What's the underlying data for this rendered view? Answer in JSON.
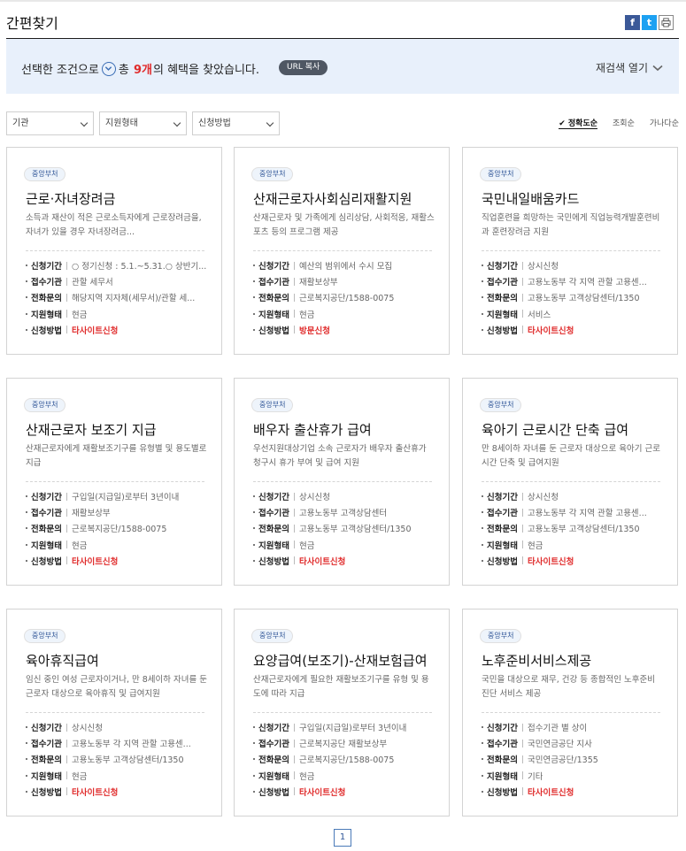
{
  "page": {
    "title": "간편찾기",
    "share_icons": [
      "facebook-icon",
      "twitter-icon",
      "print-icon"
    ]
  },
  "banner": {
    "text_before": "선택한 조건으로",
    "text_mid": "총",
    "count": "9개",
    "text_after": "의 혜택을 찾았습니다.",
    "url_copy": "URL 복사",
    "research_label": "재검색 열기"
  },
  "filters": [
    {
      "value": "기관"
    },
    {
      "value": "지원형태"
    },
    {
      "value": "신청방법"
    }
  ],
  "sort": {
    "accuracy": "정확도순",
    "views": "조회순",
    "alphabetical": "가나다순"
  },
  "labels": {
    "period": "신청기간",
    "agency": "접수기관",
    "phone": "전화문의",
    "support": "지원형태",
    "method": "신청방법"
  },
  "cards": [
    {
      "badge": "중앙부처",
      "title": "근로·자녀장려금",
      "desc": "소득과 재산이 적은 근로소득자에게 근로장려금을, 자녀가 있을 경우 자녀장려금...",
      "period": "○ 정기신청 : 5.1.~5.31.○ 상반기...",
      "agency": "관할 세무서",
      "phone": "해당지역 지자체(세무서)/관할 세...",
      "support": "현금",
      "method": "타사이트신청",
      "method_red": true
    },
    {
      "badge": "중앙부처",
      "title": "산재근로자사회심리재활지원",
      "desc": "산재근로자 및 가족에게 심리상담, 사회적응, 재활스포츠 등의 프로그램 제공",
      "period": "예산의 범위에서 수시 모집",
      "agency": "재활보상부",
      "phone": "근로복지공단/1588-0075",
      "support": "현금",
      "method": "방문신청",
      "method_red": true
    },
    {
      "badge": "중앙부처",
      "title": "국민내일배움카드",
      "desc": "직업훈련을 희망하는 국민에게 직업능력개발훈련비과 훈련장려금 지원",
      "period": "상시신청",
      "agency": "고용노동부 각 지역 관할 고용센...",
      "phone": "고용노동부 고객상담센터/1350",
      "support": "서비스",
      "method": "타사이트신청",
      "method_red": true
    },
    {
      "badge": "중앙부처",
      "title": "산재근로자 보조기 지급",
      "desc": "산재근로자에게 재활보조기구를 유형별 및 용도별로 지급",
      "period": "구입일(지급일)로부터 3년이내",
      "agency": "재활보상부",
      "phone": "근로복지공단/1588-0075",
      "support": "현금",
      "method": "타사이트신청",
      "method_red": true
    },
    {
      "badge": "중앙부처",
      "title": "배우자 출산휴가 급여",
      "desc": "우선지원대상기업 소속 근로자가 배우자 출산휴가 청구시 휴가 부여 및 급여 지원",
      "period": "상시신청",
      "agency": "고용노동부 고객상담센터",
      "phone": "고용노동부 고객상담센터/1350",
      "support": "현금",
      "method": "타사이트신청",
      "method_red": true
    },
    {
      "badge": "중앙부처",
      "title": "육아기 근로시간 단축 급여",
      "desc": "만 8세이하 자녀를 둔 근로자 대상으로 육아기 근로시간 단축 및 급여지원",
      "period": "상시신청",
      "agency": "고용노동부 각 지역 관할 고용센...",
      "phone": "고용노동부 고객상담센터/1350",
      "support": "현금",
      "method": "타사이트신청",
      "method_red": true
    },
    {
      "badge": "중앙부처",
      "title": "육아휴직급여",
      "desc": "임신 중인 여성 근로자이거나, 만 8세이하 자녀를 둔 근로자 대상으로 육아휴직 및 급여지원",
      "period": "상시신청",
      "agency": "고용노동부 각 지역 관할 고용센...",
      "phone": "고용노동부 고객상담센터/1350",
      "support": "현금",
      "method": "타사이트신청",
      "method_red": true
    },
    {
      "badge": "중앙부처",
      "title": "요양급여(보조기)-산재보험급여",
      "desc": "산재근로자에게 필요한 재활보조기구를 유형 및 용도에 따라 지급",
      "period": "구입일(지급일)로부터 3년이내",
      "agency": "근로복지공단 재활보상부",
      "phone": "근로복지공단/1588-0075",
      "support": "현금",
      "method": "타사이트신청",
      "method_red": true
    },
    {
      "badge": "중앙부처",
      "title": "노후준비서비스제공",
      "desc": "국민을 대상으로 재무, 건강 등 종합적인 노후준비 진단 서비스 제공",
      "period": "접수기관 별 상이",
      "agency": "국민연금공단 지사",
      "phone": "국민연금공단/1355",
      "support": "기타",
      "method": "타사이트신청",
      "method_red": true
    }
  ],
  "pagination": {
    "current": "1"
  }
}
